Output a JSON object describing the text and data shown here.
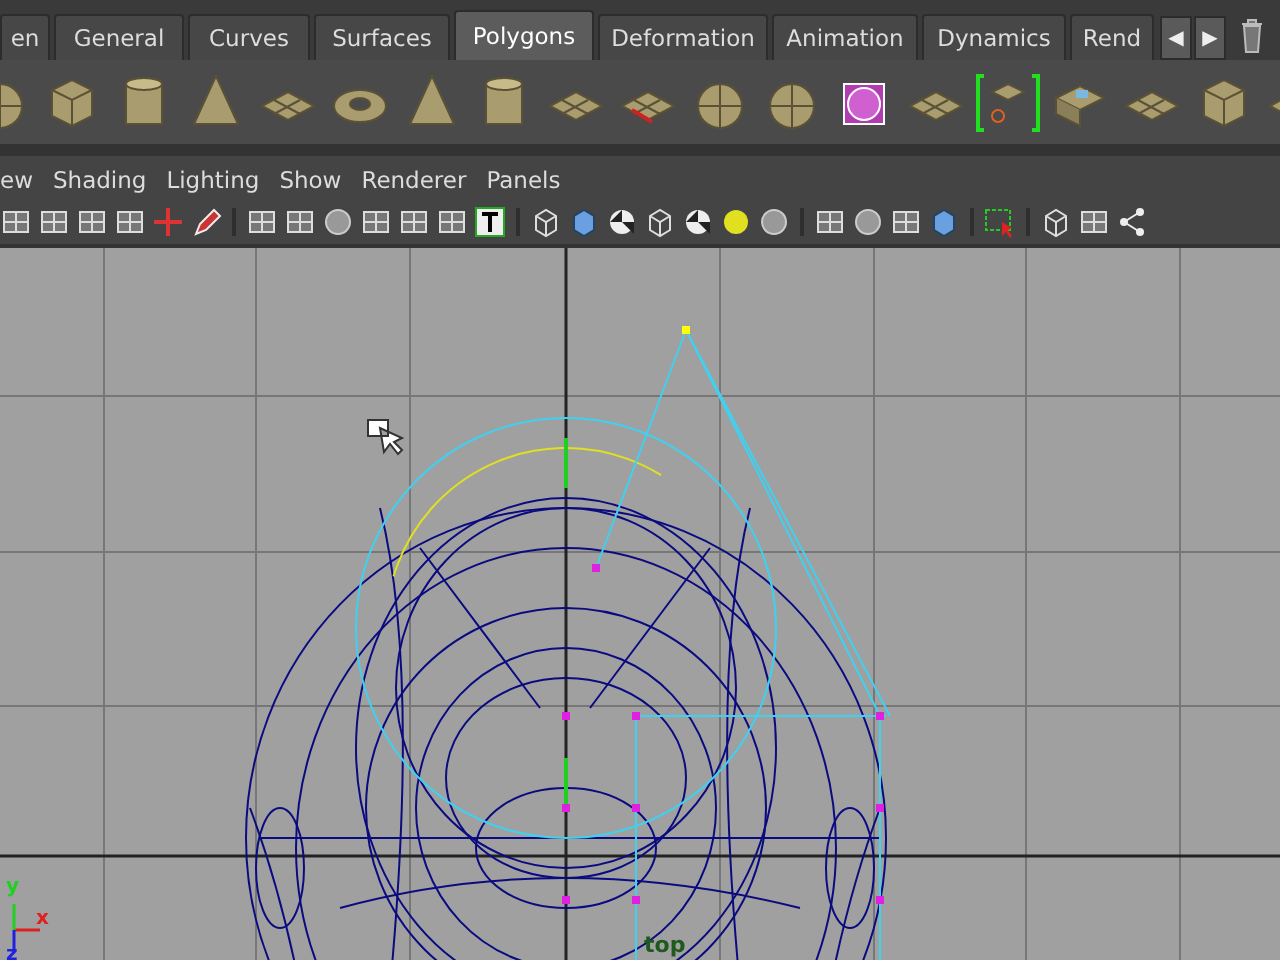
{
  "shelf_tabs": [
    {
      "label": "en",
      "selected": false
    },
    {
      "label": "General",
      "selected": false
    },
    {
      "label": "Curves",
      "selected": false
    },
    {
      "label": "Surfaces",
      "selected": false
    },
    {
      "label": "Polygons",
      "selected": true
    },
    {
      "label": "Deformation",
      "selected": false
    },
    {
      "label": "Animation",
      "selected": false
    },
    {
      "label": "Dynamics",
      "selected": false
    },
    {
      "label": "Rend",
      "selected": false
    }
  ],
  "shelf_scroll": {
    "left": "◀",
    "right": "▶"
  },
  "panel_menu": [
    "ew",
    "Shading",
    "Lighting",
    "Show",
    "Renderer",
    "Panels"
  ],
  "viewport": {
    "camera_label": "top",
    "axis": {
      "y": "y",
      "x": "x",
      "z": "z"
    }
  }
}
